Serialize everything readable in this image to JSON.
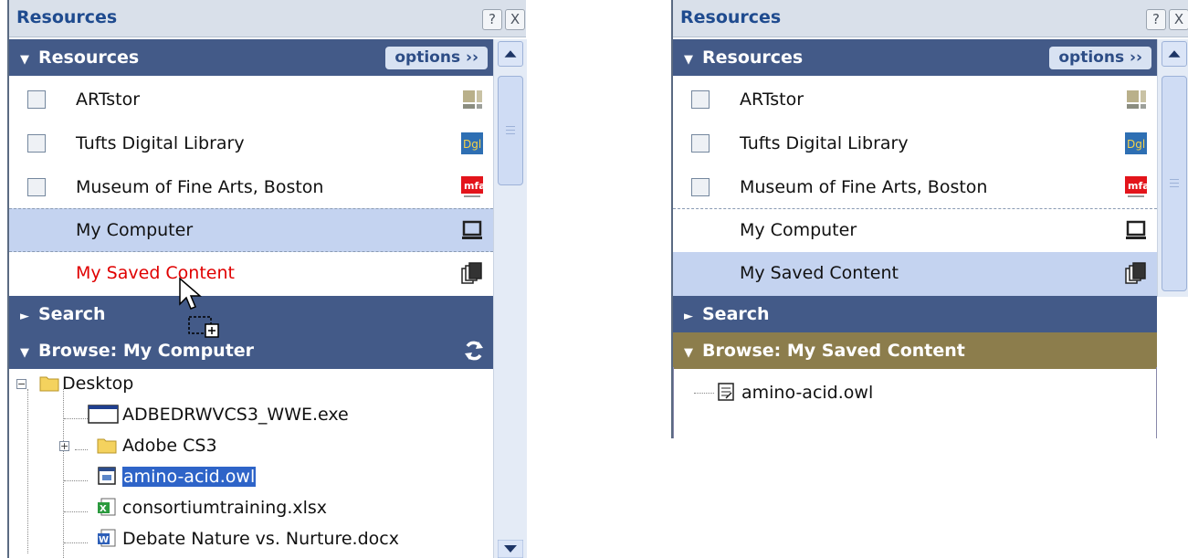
{
  "left": {
    "title": "Resources",
    "help_label": "?",
    "close_label": "X",
    "resources_header": "Resources",
    "options_label": "options ››",
    "resources": [
      {
        "label": "ARTstor",
        "has_checkbox": true,
        "icon": "artstor-icon"
      },
      {
        "label": "Tufts Digital Library",
        "has_checkbox": true,
        "icon": "tufts-icon"
      },
      {
        "label": "Museum of Fine Arts, Boston",
        "has_checkbox": true,
        "icon": "mfa-icon"
      },
      {
        "label": "My Computer",
        "has_checkbox": false,
        "icon": "computer-icon",
        "selected": true
      },
      {
        "label": "My Saved Content",
        "has_checkbox": false,
        "icon": "saved-content-icon",
        "drop_target": true
      }
    ],
    "search_header": "Search",
    "browse_header": "Browse: My Computer",
    "tree": {
      "root": "Desktop",
      "children": [
        {
          "label": "ADBEDRWVCS3_WWE.exe",
          "icon": "exe-icon"
        },
        {
          "label": "Adobe CS3",
          "icon": "folder-icon",
          "collapsed": true
        },
        {
          "label": "amino-acid.owl",
          "icon": "owl-file-icon",
          "selected": true
        },
        {
          "label": "consortiumtraining.xlsx",
          "icon": "excel-icon"
        },
        {
          "label": "Debate Nature vs. Nurture.docx",
          "icon": "word-icon"
        }
      ]
    }
  },
  "right": {
    "title": "Resources",
    "help_label": "?",
    "close_label": "X",
    "resources_header": "Resources",
    "options_label": "options ››",
    "resources": [
      {
        "label": "ARTstor",
        "has_checkbox": true,
        "icon": "artstor-icon"
      },
      {
        "label": "Tufts Digital Library",
        "has_checkbox": true,
        "icon": "tufts-icon"
      },
      {
        "label": "Museum of Fine Arts, Boston",
        "has_checkbox": true,
        "icon": "mfa-icon"
      },
      {
        "label": "My Computer",
        "has_checkbox": false,
        "icon": "computer-icon"
      },
      {
        "label": "My Saved Content",
        "has_checkbox": false,
        "icon": "saved-content-icon",
        "selected": true
      }
    ],
    "search_header": "Search",
    "browse_header": "Browse: My Saved Content",
    "files": [
      {
        "label": "amino-acid.owl",
        "icon": "document-icon"
      }
    ]
  },
  "colors": {
    "header_blue": "#435a88",
    "header_gold": "#8c7d4c",
    "selection": "#c4d3f0",
    "title_text": "#1f4b8f",
    "drop_text": "#e00000"
  }
}
